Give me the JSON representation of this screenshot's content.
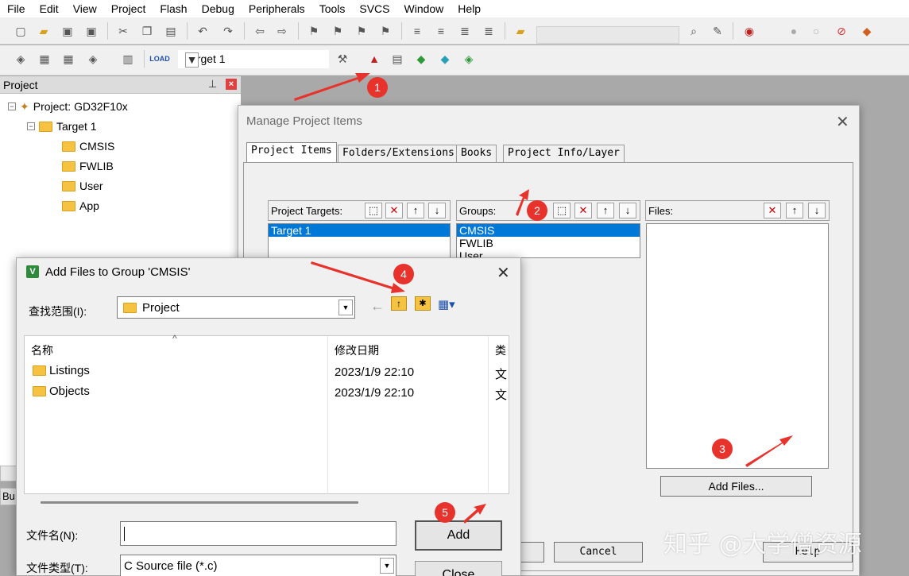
{
  "menu": [
    "File",
    "Edit",
    "View",
    "Project",
    "Flash",
    "Debug",
    "Peripherals",
    "Tools",
    "SVCS",
    "Window",
    "Help"
  ],
  "toolbar": {
    "target_combo": "Target 1"
  },
  "project_panel": {
    "title": "Project",
    "tree": {
      "root": "Project: GD32F10x",
      "target": "Target 1",
      "groups": [
        "CMSIS",
        "FWLIB",
        "User",
        "App"
      ]
    }
  },
  "manage_dialog": {
    "title": "Manage Project Items",
    "tabs": [
      "Project Items",
      "Folders/Extensions",
      "Books",
      "Project Info/Layer"
    ],
    "targets_label": "Project Targets:",
    "targets": [
      "Target 1"
    ],
    "groups_label": "Groups:",
    "groups": [
      "CMSIS",
      "FWLIB",
      "User"
    ],
    "files_label": "Files:",
    "add_files": "Add Files...",
    "cancel": "Cancel",
    "help": "Help"
  },
  "add_dialog": {
    "title": "Add Files to Group 'CMSIS'",
    "look_in_label": "查找范围(I):",
    "look_in_value": "Project",
    "col_name": "名称",
    "col_date": "修改日期",
    "col_type": "类",
    "rows": [
      {
        "name": "Listings",
        "date": "2023/1/9 22:10",
        "type": "文"
      },
      {
        "name": "Objects",
        "date": "2023/1/9 22:10",
        "type": "文"
      }
    ],
    "file_name_label": "文件名(N):",
    "file_name_value": "",
    "file_type_label": "文件类型(T):",
    "file_type_value": "C Source file (*.c)",
    "add": "Add",
    "close": "Close"
  },
  "annotations": [
    "1",
    "2",
    "3",
    "4",
    "5"
  ],
  "watermark": "知乎 @大学僧资源",
  "colors": {
    "annotation": "#e8322c",
    "selection": "#0078d7"
  }
}
